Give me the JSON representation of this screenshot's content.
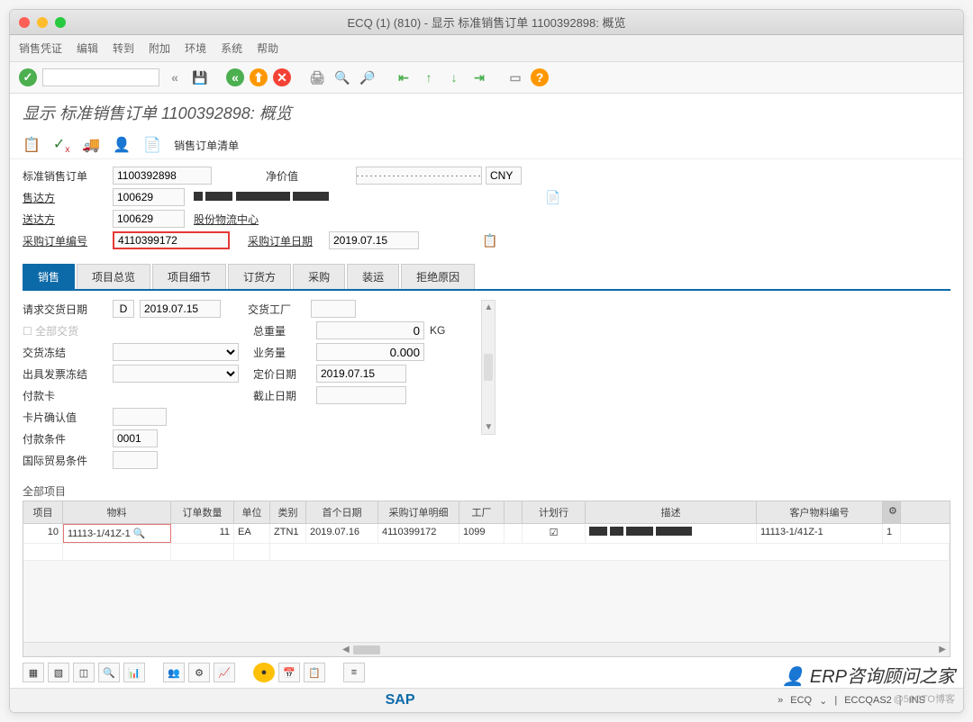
{
  "window": {
    "title": "ECQ (1) (810) - 显示 标准销售订单 1100392898: 概览"
  },
  "menu": {
    "items": [
      "销售凭证",
      "编辑",
      "转到",
      "附加",
      "环境",
      "系统",
      "帮助"
    ]
  },
  "page": {
    "title": "显示 标准销售订单 1100392898: 概览"
  },
  "actionbar": {
    "sales_order_list": "销售订单清单"
  },
  "header": {
    "std_order_label": "标准销售订单",
    "std_order_val": "1100392898",
    "net_value_label": "净价值",
    "currency": "CNY",
    "sold_to_label": "售达方",
    "sold_to_val": "100629",
    "ship_to_label": "送达方",
    "ship_to_val": "100629",
    "ship_to_desc": "股份物流中心",
    "po_num_label": "采购订单编号",
    "po_num_val": "4110399172",
    "po_date_label": "采购订单日期",
    "po_date_val": "2019.07.15"
  },
  "tabs": [
    "销售",
    "项目总览",
    "项目细节",
    "订货方",
    "采购",
    "装运",
    "拒绝原因"
  ],
  "sales": {
    "req_date_label": "请求交货日期",
    "req_date_type": "D",
    "req_date_val": "2019.07.15",
    "deliv_plant_label": "交货工厂",
    "full_deliv_label": "全部交货",
    "total_weight_label": "总重量",
    "total_weight_val": "0",
    "weight_unit": "KG",
    "deliv_block_label": "交货冻结",
    "biz_vol_label": "业务量",
    "biz_vol_val": "0.000",
    "bill_block_label": "出具发票冻结",
    "pricing_date_label": "定价日期",
    "pricing_date_val": "2019.07.15",
    "pay_card_label": "付款卡",
    "due_date_label": "截止日期",
    "card_conf_label": "卡片确认值",
    "pay_terms_label": "付款条件",
    "pay_terms_val": "0001",
    "incoterms_label": "国际贸易条件"
  },
  "grid": {
    "section_label": "全部项目",
    "headers": [
      "项目",
      "物料",
      "订单数量",
      "单位",
      "类别",
      "首个日期",
      "采购订单明细",
      "工厂",
      "",
      "计划行",
      "描述",
      "客户物料编号"
    ],
    "row1": {
      "item": "10",
      "material": "11113-1/41Z-1",
      "qty": "11",
      "unit": "EA",
      "cat": "ZTN1",
      "first_date": "2019.07.16",
      "po_item": "4110399172",
      "plant": "1099",
      "desc": "",
      "cust_mat": "11113-1/41Z-1",
      "last": "1"
    }
  },
  "status": {
    "ecq": "ECQ",
    "server": "ECCQAS2",
    "mode": "INS"
  },
  "watermark": {
    "text": "ERP咨询顾问之家",
    "sub": "@51CTO博客"
  }
}
